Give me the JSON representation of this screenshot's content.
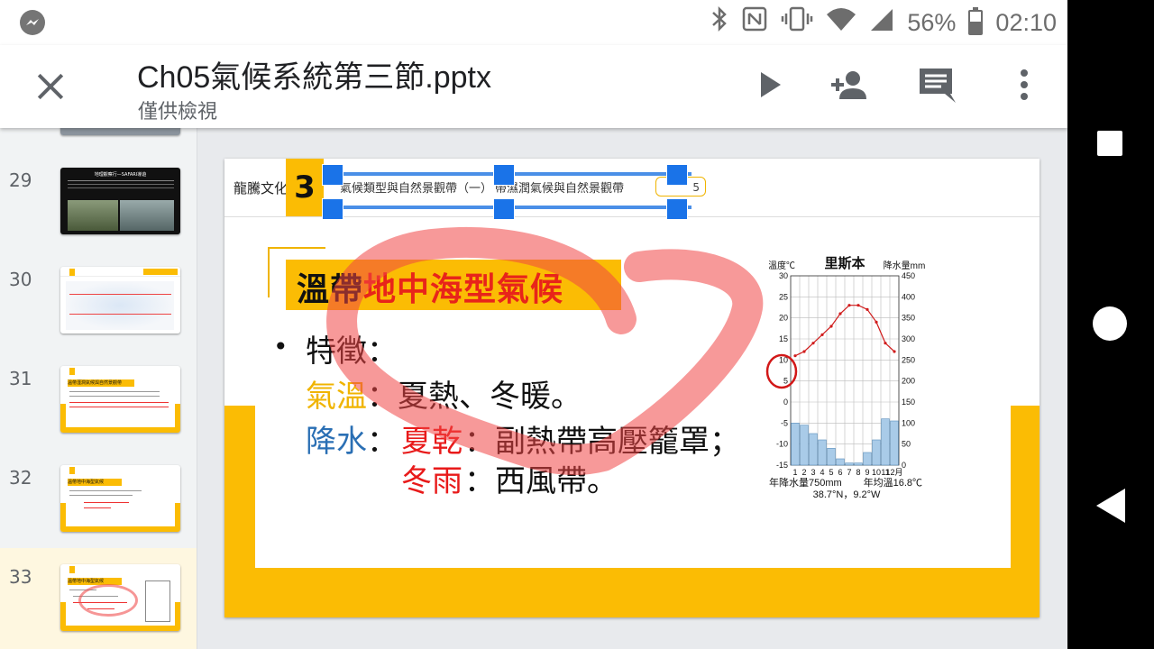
{
  "status_bar": {
    "battery": "56%",
    "time": "02:10",
    "icons": [
      "messenger-icon",
      "bluetooth-icon",
      "nfc-icon",
      "vibrate-icon",
      "wifi-icon",
      "signal-icon",
      "battery-icon"
    ],
    "battery_level": 0.56
  },
  "app_bar": {
    "title": "Ch05氣候系統第三節.pptx",
    "subtitle": "僅供檢視",
    "actions": [
      "present-icon",
      "add-person-icon",
      "comment-icon",
      "more-vert-icon"
    ]
  },
  "sidebar": {
    "slides": [
      {
        "num": "29"
      },
      {
        "num": "30"
      },
      {
        "num": "31"
      },
      {
        "num": "32"
      },
      {
        "num": "33",
        "selected": true
      }
    ],
    "thumb29_text": "地理觀察行—SAFARI導遊",
    "thumb31_title": "溫帶溼潤氣候與自然景觀帶",
    "thumb32_title": "溫帶地中海型氣候",
    "thumb33_title": "溫帶地中海型氣候"
  },
  "slide": {
    "publisher": "龍騰文化",
    "chapter": "3",
    "tab1": "氣候類型與自然景觀帶（一）",
    "tab2": "帶濕潤氣候與自然景觀帶",
    "page": "5",
    "title_black": "溫帶",
    "title_red": "地中海型氣候",
    "bullet": "•",
    "feature_label": "特徵：",
    "temp_label": "氣溫",
    "temp_text": "：夏熱、冬暖。",
    "precip_label": "降水",
    "colon": "：",
    "summer_dry": "夏乾",
    "summer_text": "：副熱帶高壓籠罩；",
    "winter_rain": "冬雨",
    "winter_text": "：西風帶。"
  },
  "chart_data": {
    "type": "bar",
    "title": "里斯本",
    "ylabel_left": "溫度℃",
    "ylabel_right": "降水量mm",
    "categories": [
      "1",
      "2",
      "3",
      "4",
      "5",
      "6",
      "7",
      "8",
      "9",
      "10",
      "11",
      "12月"
    ],
    "temp_ticks": [
      "30",
      "25",
      "20",
      "15",
      "10",
      "5",
      "0",
      "-5",
      "-10",
      "-15"
    ],
    "precip_ticks": [
      "450",
      "400",
      "350",
      "300",
      "250",
      "200",
      "150",
      "100",
      "50",
      "0"
    ],
    "ylim_temp": [
      -15,
      30
    ],
    "ylim_precip": [
      0,
      450
    ],
    "series": [
      {
        "values": [
          11,
          12,
          14,
          16,
          18,
          21,
          23,
          23,
          22,
          19,
          14,
          12
        ]
      },
      {
        "values": [
          100,
          95,
          75,
          60,
          40,
          15,
          5,
          5,
          30,
          60,
          110,
          105
        ]
      }
    ],
    "footer_left": "年降水量750mm",
    "footer_right": "年均溫16.8℃",
    "coords": "38.7°N，9.2°W"
  }
}
